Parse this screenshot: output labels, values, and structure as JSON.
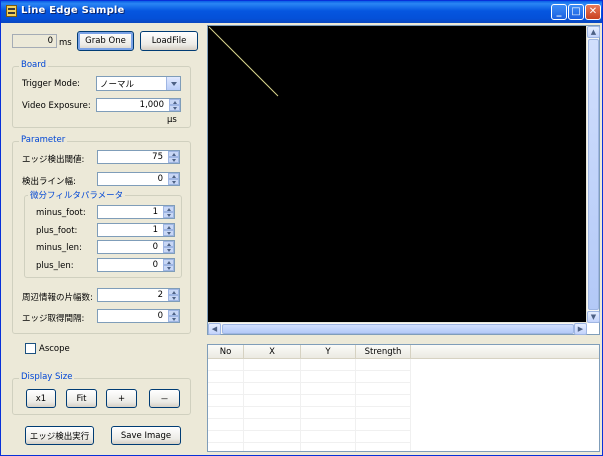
{
  "window": {
    "title": "Line Edge Sample",
    "controls": {
      "minimize": "_",
      "maximize": "□",
      "close": "✕"
    }
  },
  "top": {
    "ms_value": "0",
    "ms_unit": "ms",
    "grab_one": "Grab One",
    "load_file": "LoadFile"
  },
  "board": {
    "title": "Board",
    "trigger_mode_label": "Trigger Mode:",
    "trigger_mode_value": "ノーマル",
    "video_exposure_label": "Video Exposure:",
    "video_exposure_value": "1,000",
    "video_exposure_unit": "μs"
  },
  "parameter": {
    "title": "Parameter",
    "edge_threshold_label": "エッジ検出閾値:",
    "edge_threshold_value": "75",
    "detect_line_width_label": "検出ライン幅:",
    "detect_line_width_value": "0",
    "diff_filter": {
      "title": "微分フィルタパラメータ",
      "minus_foot_label": "minus_foot:",
      "minus_foot_value": "1",
      "plus_foot_label": "plus_foot:",
      "plus_foot_value": "1",
      "minus_len_label": "minus_len:",
      "minus_len_value": "0",
      "plus_len_label": "plus_len:",
      "plus_len_value": "0"
    },
    "peripheral_label": "周辺情報の片幅数:",
    "peripheral_value": "2",
    "edge_interval_label": "エッジ取得間隔:",
    "edge_interval_value": "0"
  },
  "ascope": {
    "label": "Ascope",
    "checked": false
  },
  "display_size": {
    "title": "Display Size",
    "x1": "x1",
    "fit": "Fit",
    "plus": "+",
    "minus": "－"
  },
  "actions": {
    "run_edge_detect": "エッジ検出実行",
    "save_image": "Save Image"
  },
  "results": {
    "columns": [
      "No",
      "X",
      "Y",
      "Strength"
    ],
    "rows": []
  },
  "colors": {
    "titlebar": "#0556e0",
    "group_title": "#0046d5",
    "canvas": "#000000",
    "edge_line": "#d8d48c"
  }
}
